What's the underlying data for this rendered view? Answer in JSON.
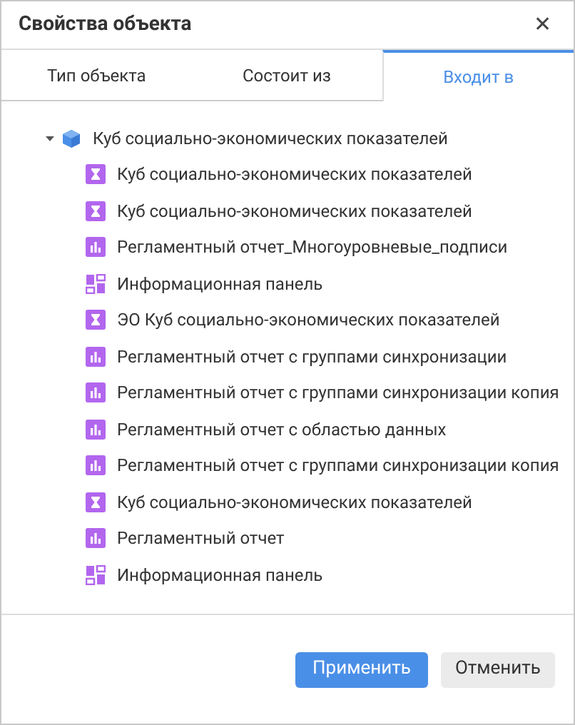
{
  "window": {
    "title": "Свойства объекта",
    "close": "✕"
  },
  "tabs": [
    {
      "label": "Тип объекта",
      "selected": false
    },
    {
      "label": "Состоит из",
      "selected": false
    },
    {
      "label": "Входит в",
      "selected": true
    }
  ],
  "tree": [
    {
      "label": "Куб социально-экономических показателей",
      "kind": "blue_cube",
      "expanded": true,
      "children": [
        {
          "label": "Куб социально-экономических показателей",
          "kind": "cube"
        },
        {
          "label": "Куб социально-экономических показателей",
          "kind": "cube"
        },
        {
          "label": "Регламентный отчет_Многоуровневые_подписи",
          "kind": "report"
        },
        {
          "label": "Информационная панель",
          "kind": "dashboard"
        },
        {
          "label": "ЭО Куб социально-экономических показателей",
          "kind": "cube"
        },
        {
          "label": "Регламентный отчет с группами синхронизации",
          "kind": "report"
        },
        {
          "label": "Регламентный отчет с группами синхронизации копия",
          "kind": "report"
        },
        {
          "label": "Регламентный отчет с областью данных",
          "kind": "report"
        },
        {
          "label": "Регламентный отчет с группами синхронизации копия",
          "kind": "report"
        },
        {
          "label": "Куб социально-экономических показателей",
          "kind": "cube"
        },
        {
          "label": "Регламентный отчет",
          "kind": "report"
        },
        {
          "label": "Информационная панель",
          "kind": "dashboard"
        }
      ]
    }
  ],
  "buttons": [
    {
      "label": "Применить",
      "kind": "primary"
    },
    {
      "label": "Отменить",
      "kind": "secondary"
    }
  ]
}
